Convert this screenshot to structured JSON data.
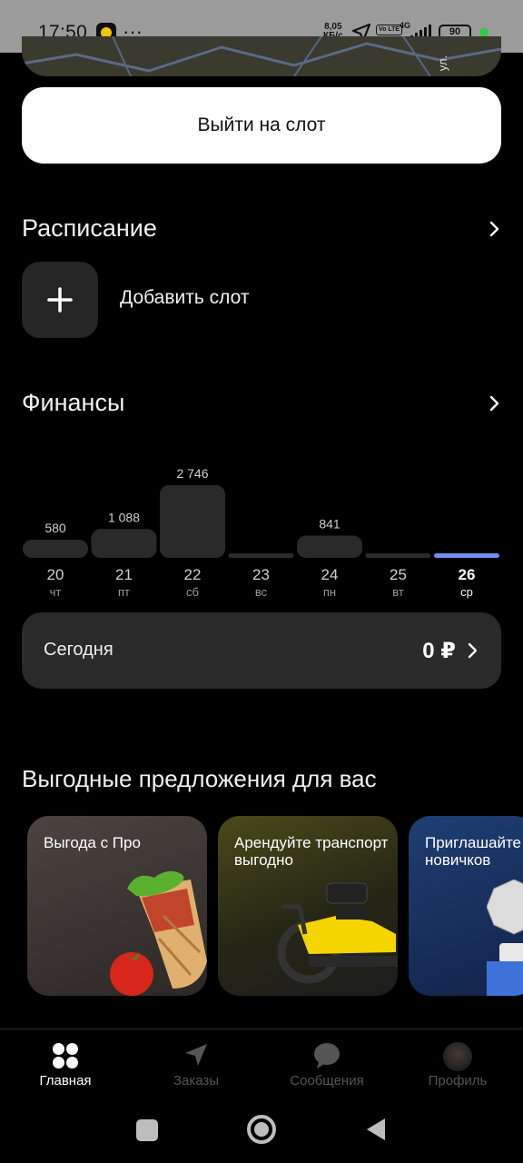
{
  "status_bar": {
    "time": "17:50",
    "more": "···",
    "speed_value": "8,05",
    "speed_unit": "КБ/с",
    "volte": "Vo LTE",
    "network": "4G",
    "battery": "90",
    "icons": [
      "yandex-pro-app-icon",
      "navigation-arrow-icon",
      "signal-icon",
      "battery-icon"
    ]
  },
  "map": {
    "street_label": "ул."
  },
  "go_button": {
    "label": "Выйти на слот"
  },
  "schedule": {
    "title": "Расписание",
    "add_slot_label": "Добавить слот"
  },
  "finances": {
    "title": "Финансы"
  },
  "chart_data": {
    "type": "bar",
    "categories": [
      "20",
      "21",
      "22",
      "23",
      "24",
      "25",
      "26"
    ],
    "weekdays": [
      "чт",
      "пт",
      "сб",
      "вс",
      "пн",
      "вт",
      "ср"
    ],
    "values": [
      580,
      1088,
      2746,
      0,
      841,
      0,
      0
    ],
    "value_labels": [
      "580",
      "1 088",
      "2 746",
      "",
      "841",
      "",
      ""
    ],
    "highlight_index": 6,
    "highlight_color": "#6c8ef5",
    "bar_color": "#2a2a2a"
  },
  "today": {
    "label": "Сегодня",
    "value": "0 ₽"
  },
  "offers": {
    "title": "Выгодные предложения для вас",
    "cards": [
      {
        "text": "Выгода с Про",
        "image": "shawarma-tomato-illustration"
      },
      {
        "text": "Арендуйте транспорт выгодно",
        "image": "yellow-scooter-illustration"
      },
      {
        "text": "Приглашайте новичков",
        "image": "medal-illustration"
      }
    ]
  },
  "tabbar": {
    "tabs": [
      {
        "label": "Главная",
        "icon": "home-grid-icon",
        "active": true
      },
      {
        "label": "Заказы",
        "icon": "navigation-arrow-icon",
        "active": false
      },
      {
        "label": "Сообщения",
        "icon": "chat-bubble-icon",
        "active": false
      },
      {
        "label": "Профиль",
        "icon": "avatar",
        "active": false
      }
    ]
  }
}
